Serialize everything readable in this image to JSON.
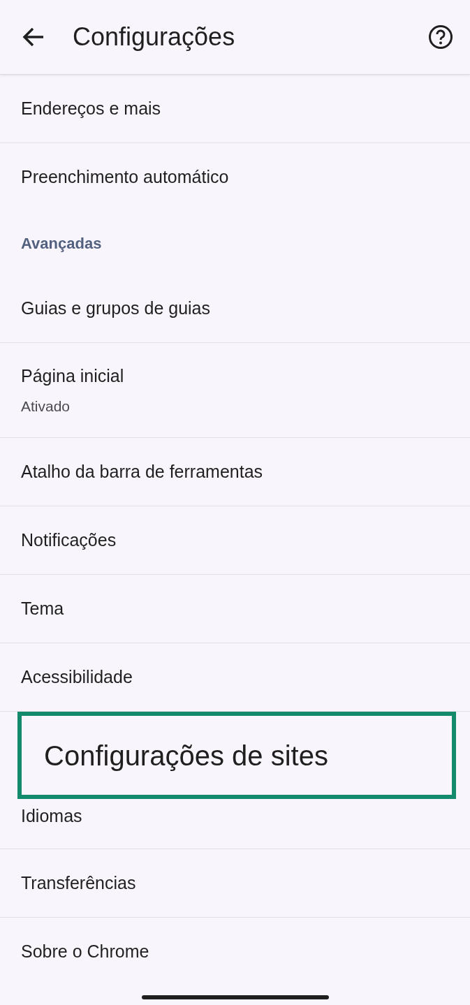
{
  "header": {
    "title": "Configurações"
  },
  "items": [
    {
      "kind": "item",
      "label": "Endereços e mais"
    },
    {
      "kind": "item",
      "label": "Preenchimento automático",
      "divider": false
    },
    {
      "kind": "section",
      "label": "Avançadas"
    },
    {
      "kind": "item",
      "label": "Guias e grupos de guias"
    },
    {
      "kind": "item",
      "label": "Página inicial",
      "subtitle": "Ativado"
    },
    {
      "kind": "item",
      "label": "Atalho da barra de ferramentas"
    },
    {
      "kind": "item",
      "label": "Notificações"
    },
    {
      "kind": "item",
      "label": "Tema"
    },
    {
      "kind": "item",
      "label": "Acessibilidade"
    },
    {
      "kind": "callout",
      "label": "Configurações de sites",
      "color": "#148a6c"
    },
    {
      "kind": "item",
      "label": "Idiomas"
    },
    {
      "kind": "item",
      "label": "Transferências"
    },
    {
      "kind": "item",
      "label": "Sobre o Chrome",
      "divider": false
    }
  ]
}
